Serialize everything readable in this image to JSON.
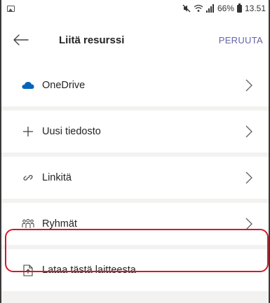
{
  "status_bar": {
    "battery_percent": "66%",
    "time": "13.51",
    "icons": [
      "image-icon",
      "mute-icon",
      "wifi-icon",
      "signal-icon",
      "battery-icon"
    ]
  },
  "header": {
    "title": "Liitä resurssi",
    "cancel_label": "PERUUTA",
    "back_icon": "back-arrow-icon"
  },
  "items": [
    {
      "label": "OneDrive",
      "icon": "onedrive-icon",
      "chevron": true
    },
    {
      "label": "Uusi tiedosto",
      "icon": "plus-icon",
      "chevron": true
    },
    {
      "label": "Linkitä",
      "icon": "link-icon",
      "chevron": true
    },
    {
      "label": "Ryhmät",
      "icon": "teams-icon",
      "chevron": true
    },
    {
      "label": "Lataa tästä laitteesta",
      "icon": "upload-icon",
      "chevron": false
    }
  ],
  "colors": {
    "accent": "#6264a7",
    "onedrive": "#0364b8",
    "highlight": "#d11a2a",
    "text": "#252423",
    "list_background": "#f3f2f1"
  }
}
